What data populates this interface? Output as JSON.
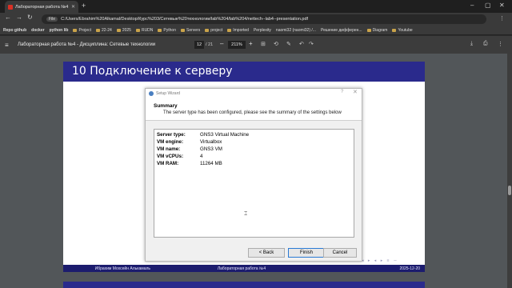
{
  "browser": {
    "tab_title": "Лабораторная работа №4 - Д",
    "new_tab": "+",
    "file_chip": "File",
    "url": "C:/Users/Ebrahim%20Alkamal/Desktop/Курс%203/Сетевые%20технологии/lab%204/lab%204/nettech--lab4--presentation.pdf",
    "bookmarks": [
      "Repo github",
      "docker",
      "python lib",
      "Project",
      "22-24",
      "2025",
      "RUDN",
      "Python",
      "Servers",
      "project",
      "Imported",
      "Perplexity",
      "naomi32 (naomi32) /...",
      "Решение дифферен...",
      "Diagram",
      "Youtube"
    ]
  },
  "pdf_toolbar": {
    "title": "Лабораторная работа №4 - Дисциплина: Сетевые технологии",
    "page_current": "12",
    "page_total": "/ 21",
    "zoom": "211%"
  },
  "slide": {
    "title": "10 Подключение к серверу",
    "footer": [
      "Ибрахим Мохсейн Алькамаль",
      "Лабораторная работа №4",
      "2025-12-20"
    ]
  },
  "dialog": {
    "window_title": "Setup Wizard",
    "help": "?",
    "close": "✕",
    "summary_title": "Summary",
    "summary_desc": "The server type has been configured, please see the summary of the settings below",
    "settings": [
      {
        "key": "Server type:",
        "value": "GNS3 Virtual Machine"
      },
      {
        "key": "VM engine:",
        "value": "Virtualbox"
      },
      {
        "key": "VM name:",
        "value": "GNS3 VM"
      },
      {
        "key": "VM vCPUs:",
        "value": "4"
      },
      {
        "key": "VM RAM:",
        "value": "11264 MB"
      }
    ],
    "back_label": "< Back",
    "finish_label": "Finish",
    "cancel_label": "Cancel"
  }
}
